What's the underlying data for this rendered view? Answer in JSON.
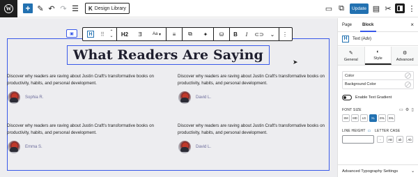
{
  "topbar": {
    "logo_glyph": "W",
    "add_glyph": "+",
    "design_library_label": "Design Library",
    "design_library_glyph": "K",
    "update_label": "Update",
    "icons": [
      "pen-icon",
      "undo-icon",
      "redo-icon",
      "list-view-icon",
      "desktop-preview-icon",
      "external-view-icon",
      "kadence-icon",
      "tools-icon",
      "settings-icon",
      "more-vertical-icon"
    ]
  },
  "toolbar": {
    "heading_level": "H2",
    "font_label": "Aa",
    "bold": "B",
    "italic": "I"
  },
  "canvas": {
    "heading": "What Readers Are Saying",
    "testimonials": [
      {
        "text": "Discover why readers are raving about Justin Craft's transformative books on productivity, habits, and personal development.",
        "author": "Sophia R."
      },
      {
        "text": "Discover why readers are raving about Justin Craft's transformative books on productivity, habits, and personal development.",
        "author": "David L."
      },
      {
        "text": "Discover why readers are raving about Justin Craft's transformative books on productivity, habits, and personal development.",
        "author": "Emma S."
      },
      {
        "text": "Discover why readers are raving about Justin Craft's transformative books on productivity, habits, and personal development.",
        "author": "David L."
      }
    ]
  },
  "sidebar": {
    "tabs": [
      "Page",
      "Block"
    ],
    "active_tab": "Block",
    "close_glyph": "×",
    "block_name": "Text (Adv)",
    "subtabs": [
      {
        "label": "General",
        "icon": "✎"
      },
      {
        "label": "Style",
        "icon": "◐"
      },
      {
        "label": "Advanced",
        "icon": "⚙"
      }
    ],
    "color_rows": [
      "Color",
      "Background Color"
    ],
    "gradient_label": "Enable Text Gradient",
    "font_size_label": "FONT SIZE",
    "font_sizes": [
      "SM",
      "MD",
      "LG",
      "XL",
      "2XL",
      "3XL"
    ],
    "active_font_size": "XL",
    "line_height_label": "LINE HEIGHT",
    "letter_case_label": "LETTER CASE",
    "letter_cases": [
      "-",
      "AB",
      "ab",
      "Ab"
    ],
    "advanced_typography": "Advanced Typography Settings",
    "advanced_glyph": "⌄"
  }
}
